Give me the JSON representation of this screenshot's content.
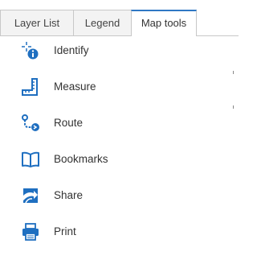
{
  "tabs": [
    {
      "label": "Layer List",
      "active": false
    },
    {
      "label": "Legend",
      "active": false
    },
    {
      "label": "Map tools",
      "active": true
    }
  ],
  "tools": [
    {
      "label": "Identify",
      "icon": "identify-icon"
    },
    {
      "label": "Measure",
      "icon": "measure-icon"
    },
    {
      "label": "Route",
      "icon": "route-icon"
    },
    {
      "label": "Bookmarks",
      "icon": "bookmarks-icon"
    },
    {
      "label": "Share",
      "icon": "share-icon"
    },
    {
      "label": "Print",
      "icon": "print-icon"
    }
  ],
  "colors": {
    "accent": "#2f78c4",
    "icon_blue": "#1f6fc0",
    "text": "#333333",
    "tab_border": "#c8c8c8",
    "tab_inactive_bg": "#f3f3f3"
  }
}
